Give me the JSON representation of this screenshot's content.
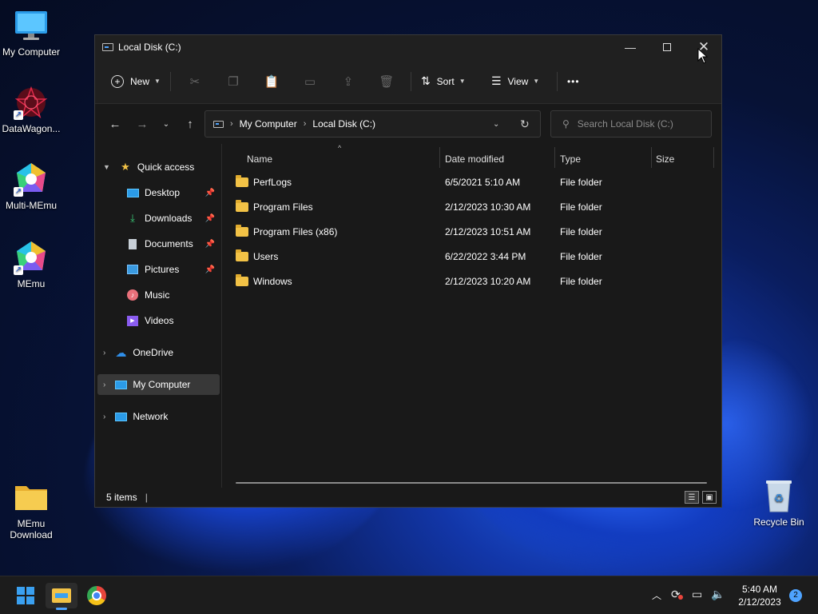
{
  "desktop": {
    "icons": [
      {
        "label": "My Computer"
      },
      {
        "label": "DataWagon..."
      },
      {
        "label": "Multi-MEmu"
      },
      {
        "label": "MEmu"
      },
      {
        "label": "MEmu\nDownload"
      },
      {
        "label": "Recycle Bin"
      }
    ]
  },
  "window": {
    "title": "Local Disk (C:)",
    "toolbar": {
      "new_label": "New",
      "sort_label": "Sort",
      "view_label": "View",
      "more_label": "•••"
    },
    "address": {
      "crumbs": [
        "My Computer",
        "Local Disk (C:)"
      ]
    },
    "search": {
      "placeholder": "Search Local Disk (C:)"
    },
    "sidebar": {
      "quick_access": "Quick access",
      "items": [
        {
          "label": "Desktop",
          "icon": "desktop-icon",
          "pinned": true
        },
        {
          "label": "Downloads",
          "icon": "download-icon",
          "pinned": true
        },
        {
          "label": "Documents",
          "icon": "document-icon",
          "pinned": true
        },
        {
          "label": "Pictures",
          "icon": "pictures-icon",
          "pinned": true
        },
        {
          "label": "Music",
          "icon": "music-icon",
          "pinned": false
        },
        {
          "label": "Videos",
          "icon": "videos-icon",
          "pinned": false
        }
      ],
      "onedrive": "OneDrive",
      "my_computer": "My Computer",
      "network": "Network"
    },
    "columns": {
      "name": "Name",
      "date": "Date modified",
      "type": "Type",
      "size": "Size"
    },
    "files": [
      {
        "name": "PerfLogs",
        "date": "6/5/2021 5:10 AM",
        "type": "File folder",
        "size": ""
      },
      {
        "name": "Program Files",
        "date": "2/12/2023 10:30 AM",
        "type": "File folder",
        "size": ""
      },
      {
        "name": "Program Files (x86)",
        "date": "2/12/2023 10:51 AM",
        "type": "File folder",
        "size": ""
      },
      {
        "name": "Users",
        "date": "6/22/2022 3:44 PM",
        "type": "File folder",
        "size": ""
      },
      {
        "name": "Windows",
        "date": "2/12/2023 10:20 AM",
        "type": "File folder",
        "size": ""
      }
    ],
    "status": {
      "count": "5 items",
      "divider": "|"
    }
  },
  "taskbar": {
    "time": "5:40 AM",
    "date": "2/12/2023",
    "notifications": "2"
  },
  "colors": {
    "accent": "#4ea3ff",
    "folder": "#f2c246",
    "window_bg": "#191919"
  }
}
